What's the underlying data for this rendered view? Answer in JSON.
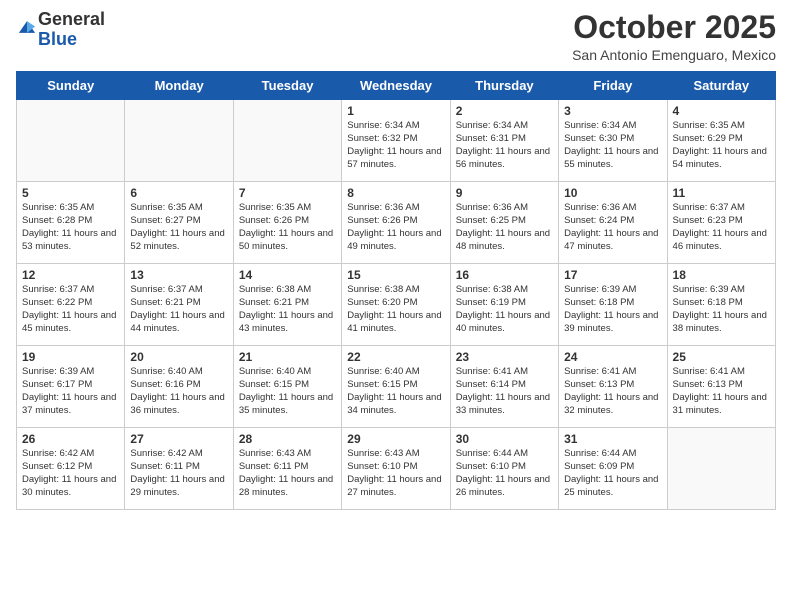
{
  "logo": {
    "general": "General",
    "blue": "Blue"
  },
  "header": {
    "month": "October 2025",
    "location": "San Antonio Emenguaro, Mexico"
  },
  "weekdays": [
    "Sunday",
    "Monday",
    "Tuesday",
    "Wednesday",
    "Thursday",
    "Friday",
    "Saturday"
  ],
  "weeks": [
    [
      {
        "day": "",
        "info": ""
      },
      {
        "day": "",
        "info": ""
      },
      {
        "day": "",
        "info": ""
      },
      {
        "day": "1",
        "info": "Sunrise: 6:34 AM\nSunset: 6:32 PM\nDaylight: 11 hours and 57 minutes."
      },
      {
        "day": "2",
        "info": "Sunrise: 6:34 AM\nSunset: 6:31 PM\nDaylight: 11 hours and 56 minutes."
      },
      {
        "day": "3",
        "info": "Sunrise: 6:34 AM\nSunset: 6:30 PM\nDaylight: 11 hours and 55 minutes."
      },
      {
        "day": "4",
        "info": "Sunrise: 6:35 AM\nSunset: 6:29 PM\nDaylight: 11 hours and 54 minutes."
      }
    ],
    [
      {
        "day": "5",
        "info": "Sunrise: 6:35 AM\nSunset: 6:28 PM\nDaylight: 11 hours and 53 minutes."
      },
      {
        "day": "6",
        "info": "Sunrise: 6:35 AM\nSunset: 6:27 PM\nDaylight: 11 hours and 52 minutes."
      },
      {
        "day": "7",
        "info": "Sunrise: 6:35 AM\nSunset: 6:26 PM\nDaylight: 11 hours and 50 minutes."
      },
      {
        "day": "8",
        "info": "Sunrise: 6:36 AM\nSunset: 6:26 PM\nDaylight: 11 hours and 49 minutes."
      },
      {
        "day": "9",
        "info": "Sunrise: 6:36 AM\nSunset: 6:25 PM\nDaylight: 11 hours and 48 minutes."
      },
      {
        "day": "10",
        "info": "Sunrise: 6:36 AM\nSunset: 6:24 PM\nDaylight: 11 hours and 47 minutes."
      },
      {
        "day": "11",
        "info": "Sunrise: 6:37 AM\nSunset: 6:23 PM\nDaylight: 11 hours and 46 minutes."
      }
    ],
    [
      {
        "day": "12",
        "info": "Sunrise: 6:37 AM\nSunset: 6:22 PM\nDaylight: 11 hours and 45 minutes."
      },
      {
        "day": "13",
        "info": "Sunrise: 6:37 AM\nSunset: 6:21 PM\nDaylight: 11 hours and 44 minutes."
      },
      {
        "day": "14",
        "info": "Sunrise: 6:38 AM\nSunset: 6:21 PM\nDaylight: 11 hours and 43 minutes."
      },
      {
        "day": "15",
        "info": "Sunrise: 6:38 AM\nSunset: 6:20 PM\nDaylight: 11 hours and 41 minutes."
      },
      {
        "day": "16",
        "info": "Sunrise: 6:38 AM\nSunset: 6:19 PM\nDaylight: 11 hours and 40 minutes."
      },
      {
        "day": "17",
        "info": "Sunrise: 6:39 AM\nSunset: 6:18 PM\nDaylight: 11 hours and 39 minutes."
      },
      {
        "day": "18",
        "info": "Sunrise: 6:39 AM\nSunset: 6:18 PM\nDaylight: 11 hours and 38 minutes."
      }
    ],
    [
      {
        "day": "19",
        "info": "Sunrise: 6:39 AM\nSunset: 6:17 PM\nDaylight: 11 hours and 37 minutes."
      },
      {
        "day": "20",
        "info": "Sunrise: 6:40 AM\nSunset: 6:16 PM\nDaylight: 11 hours and 36 minutes."
      },
      {
        "day": "21",
        "info": "Sunrise: 6:40 AM\nSunset: 6:15 PM\nDaylight: 11 hours and 35 minutes."
      },
      {
        "day": "22",
        "info": "Sunrise: 6:40 AM\nSunset: 6:15 PM\nDaylight: 11 hours and 34 minutes."
      },
      {
        "day": "23",
        "info": "Sunrise: 6:41 AM\nSunset: 6:14 PM\nDaylight: 11 hours and 33 minutes."
      },
      {
        "day": "24",
        "info": "Sunrise: 6:41 AM\nSunset: 6:13 PM\nDaylight: 11 hours and 32 minutes."
      },
      {
        "day": "25",
        "info": "Sunrise: 6:41 AM\nSunset: 6:13 PM\nDaylight: 11 hours and 31 minutes."
      }
    ],
    [
      {
        "day": "26",
        "info": "Sunrise: 6:42 AM\nSunset: 6:12 PM\nDaylight: 11 hours and 30 minutes."
      },
      {
        "day": "27",
        "info": "Sunrise: 6:42 AM\nSunset: 6:11 PM\nDaylight: 11 hours and 29 minutes."
      },
      {
        "day": "28",
        "info": "Sunrise: 6:43 AM\nSunset: 6:11 PM\nDaylight: 11 hours and 28 minutes."
      },
      {
        "day": "29",
        "info": "Sunrise: 6:43 AM\nSunset: 6:10 PM\nDaylight: 11 hours and 27 minutes."
      },
      {
        "day": "30",
        "info": "Sunrise: 6:44 AM\nSunset: 6:10 PM\nDaylight: 11 hours and 26 minutes."
      },
      {
        "day": "31",
        "info": "Sunrise: 6:44 AM\nSunset: 6:09 PM\nDaylight: 11 hours and 25 minutes."
      },
      {
        "day": "",
        "info": ""
      }
    ]
  ]
}
